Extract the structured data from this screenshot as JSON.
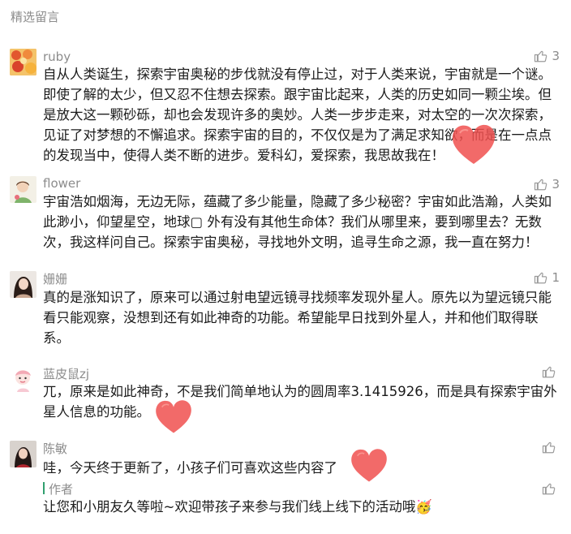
{
  "section": {
    "title": "精选留言"
  },
  "comments": [
    {
      "nickname": "ruby",
      "likes": "3",
      "text": "自从人类诞生，探索宇宙奥秘的步伐就没有停止过，对于人类来说，宇宙就是一个谜。即使了解的太少，但又忍不住想去探索。跟宇宙比起来，人类的历史如同一颗尘埃。但是放大这一颗砂砾，却也会发现许多的奥妙。人类一步步走来，对太空的一次次探索，见证了对梦想的不懈追求。探索宇宙的目的，不仅仅是为了满足求知欲，而是在一点点的发现当中，使得人类不断的进步。爱科幻，爱探索，我思故我在！"
    },
    {
      "nickname": "flower",
      "likes": "3",
      "text": "宇宙浩如烟海，无边无际，蕴藏了多少能量，隐藏了多少秘密？宇宙如此浩瀚，人类如此渺小，仰望星空，地球▢ 外有没有其他生命体？我们从哪里来，要到哪里去？无数次，我这样问自己。探索宇宙奥秘，寻找地外文明，追寻生命之源，我一直在努力！"
    },
    {
      "nickname": "姗姗",
      "likes": "1",
      "text": "真的是涨知识了，原来可以通过射电望远镜寻找频率发现外星人。原先以为望远镜只能看只能观察，没想到还有如此神奇的功能。希望能早日找到外星人，并和他们取得联系。"
    },
    {
      "nickname": "蓝皮鼠zj",
      "likes": "",
      "text": "兀，原来是如此神奇，不是我们简单地认为的圆周率3.1415926，而是具有探索宇宙外星人信息的功能。"
    },
    {
      "nickname": "陈敏",
      "likes": "",
      "text": "哇，今天终于更新了，小孩子们可喜欢这些内容了",
      "reply": {
        "author": "作者",
        "text": "让您和小朋友久等啦~欢迎带孩子来参与我们线上线下的活动哦🥳"
      }
    }
  ],
  "icons": {
    "like": "thumbs-up-icon",
    "heart": "heart-icon",
    "heart_color": "#f0504f"
  }
}
